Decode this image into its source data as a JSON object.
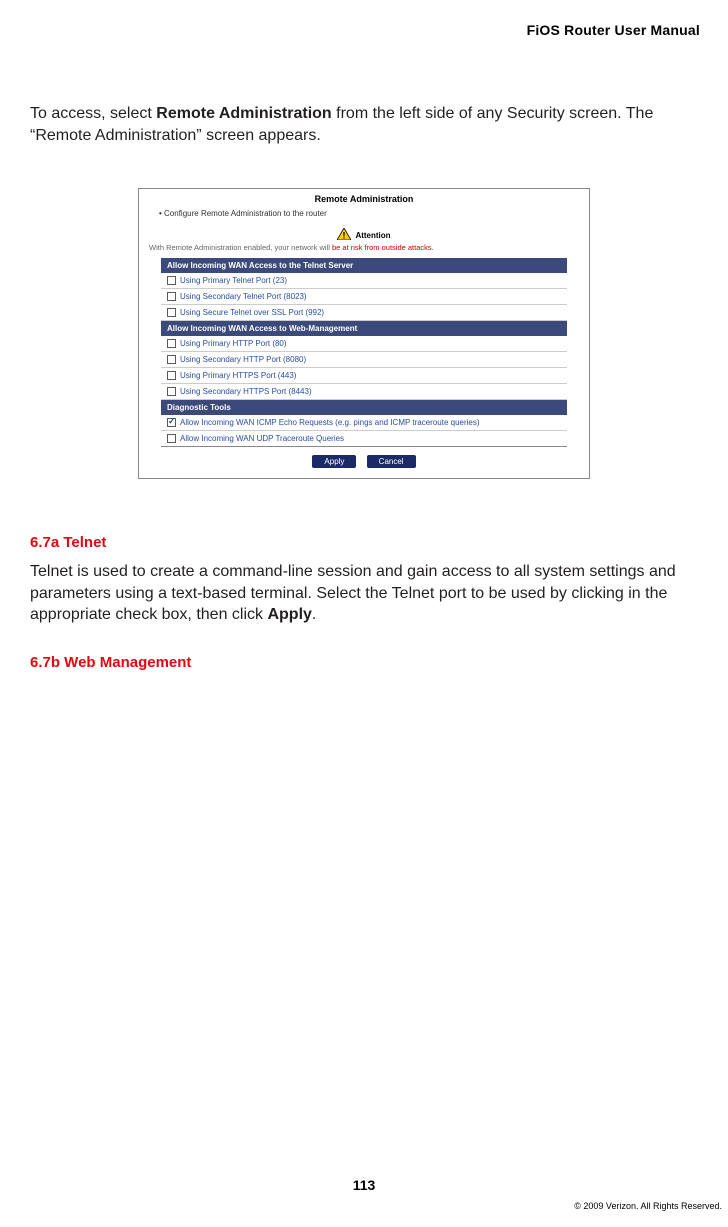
{
  "header": {
    "title": "FiOS Router User Manual"
  },
  "intro": {
    "pre": "To access, select ",
    "bold": "Remote Administration",
    "post": " from the left side of any Security screen. The “Remote Administration” screen appears."
  },
  "shot": {
    "title": "Remote Administration",
    "sub": "Configure Remote Administration to the router",
    "attention_label": "Attention",
    "attention_msg_pre": "With Remote Administration enabled, your network will ",
    "attention_msg_risk": "be at risk from outside attacks.",
    "sections": [
      {
        "header": "Allow Incoming WAN Access to the Telnet Server",
        "rows": [
          {
            "label": "Using Primary Telnet Port (23)",
            "checked": false
          },
          {
            "label": "Using Secondary Telnet Port (8023)",
            "checked": false
          },
          {
            "label": "Using Secure Telnet over SSL Port (992)",
            "checked": false
          }
        ]
      },
      {
        "header": "Allow Incoming WAN Access to Web-Management",
        "rows": [
          {
            "label": "Using Primary HTTP Port (80)",
            "checked": false
          },
          {
            "label": "Using Secondary HTTP Port (8080)",
            "checked": false
          },
          {
            "label": "Using Primary HTTPS Port (443)",
            "checked": false
          },
          {
            "label": "Using Secondary HTTPS Port (8443)",
            "checked": false
          }
        ]
      },
      {
        "header": "Diagnostic Tools",
        "rows": [
          {
            "label": "Allow Incoming WAN ICMP Echo Requests (e.g. pings and ICMP traceroute queries)",
            "checked": true
          },
          {
            "label": "Allow Incoming WAN UDP Traceroute Queries",
            "checked": false
          }
        ]
      }
    ],
    "buttons": {
      "apply": "Apply",
      "cancel": "Cancel"
    }
  },
  "sec_a": {
    "heading": "6.7a  Telnet",
    "body_pre": "Telnet is used to create a command-line session and gain access to all system settings and parameters using a text-based terminal. Select the Telnet port to be used by clicking in the appropriate check box, then click ",
    "body_bold": "Apply",
    "body_post": "."
  },
  "sec_b": {
    "heading": "6.7b  Web Management"
  },
  "footer": {
    "page": "113",
    "copyright": "© 2009 Verizon. All Rights Reserved."
  }
}
